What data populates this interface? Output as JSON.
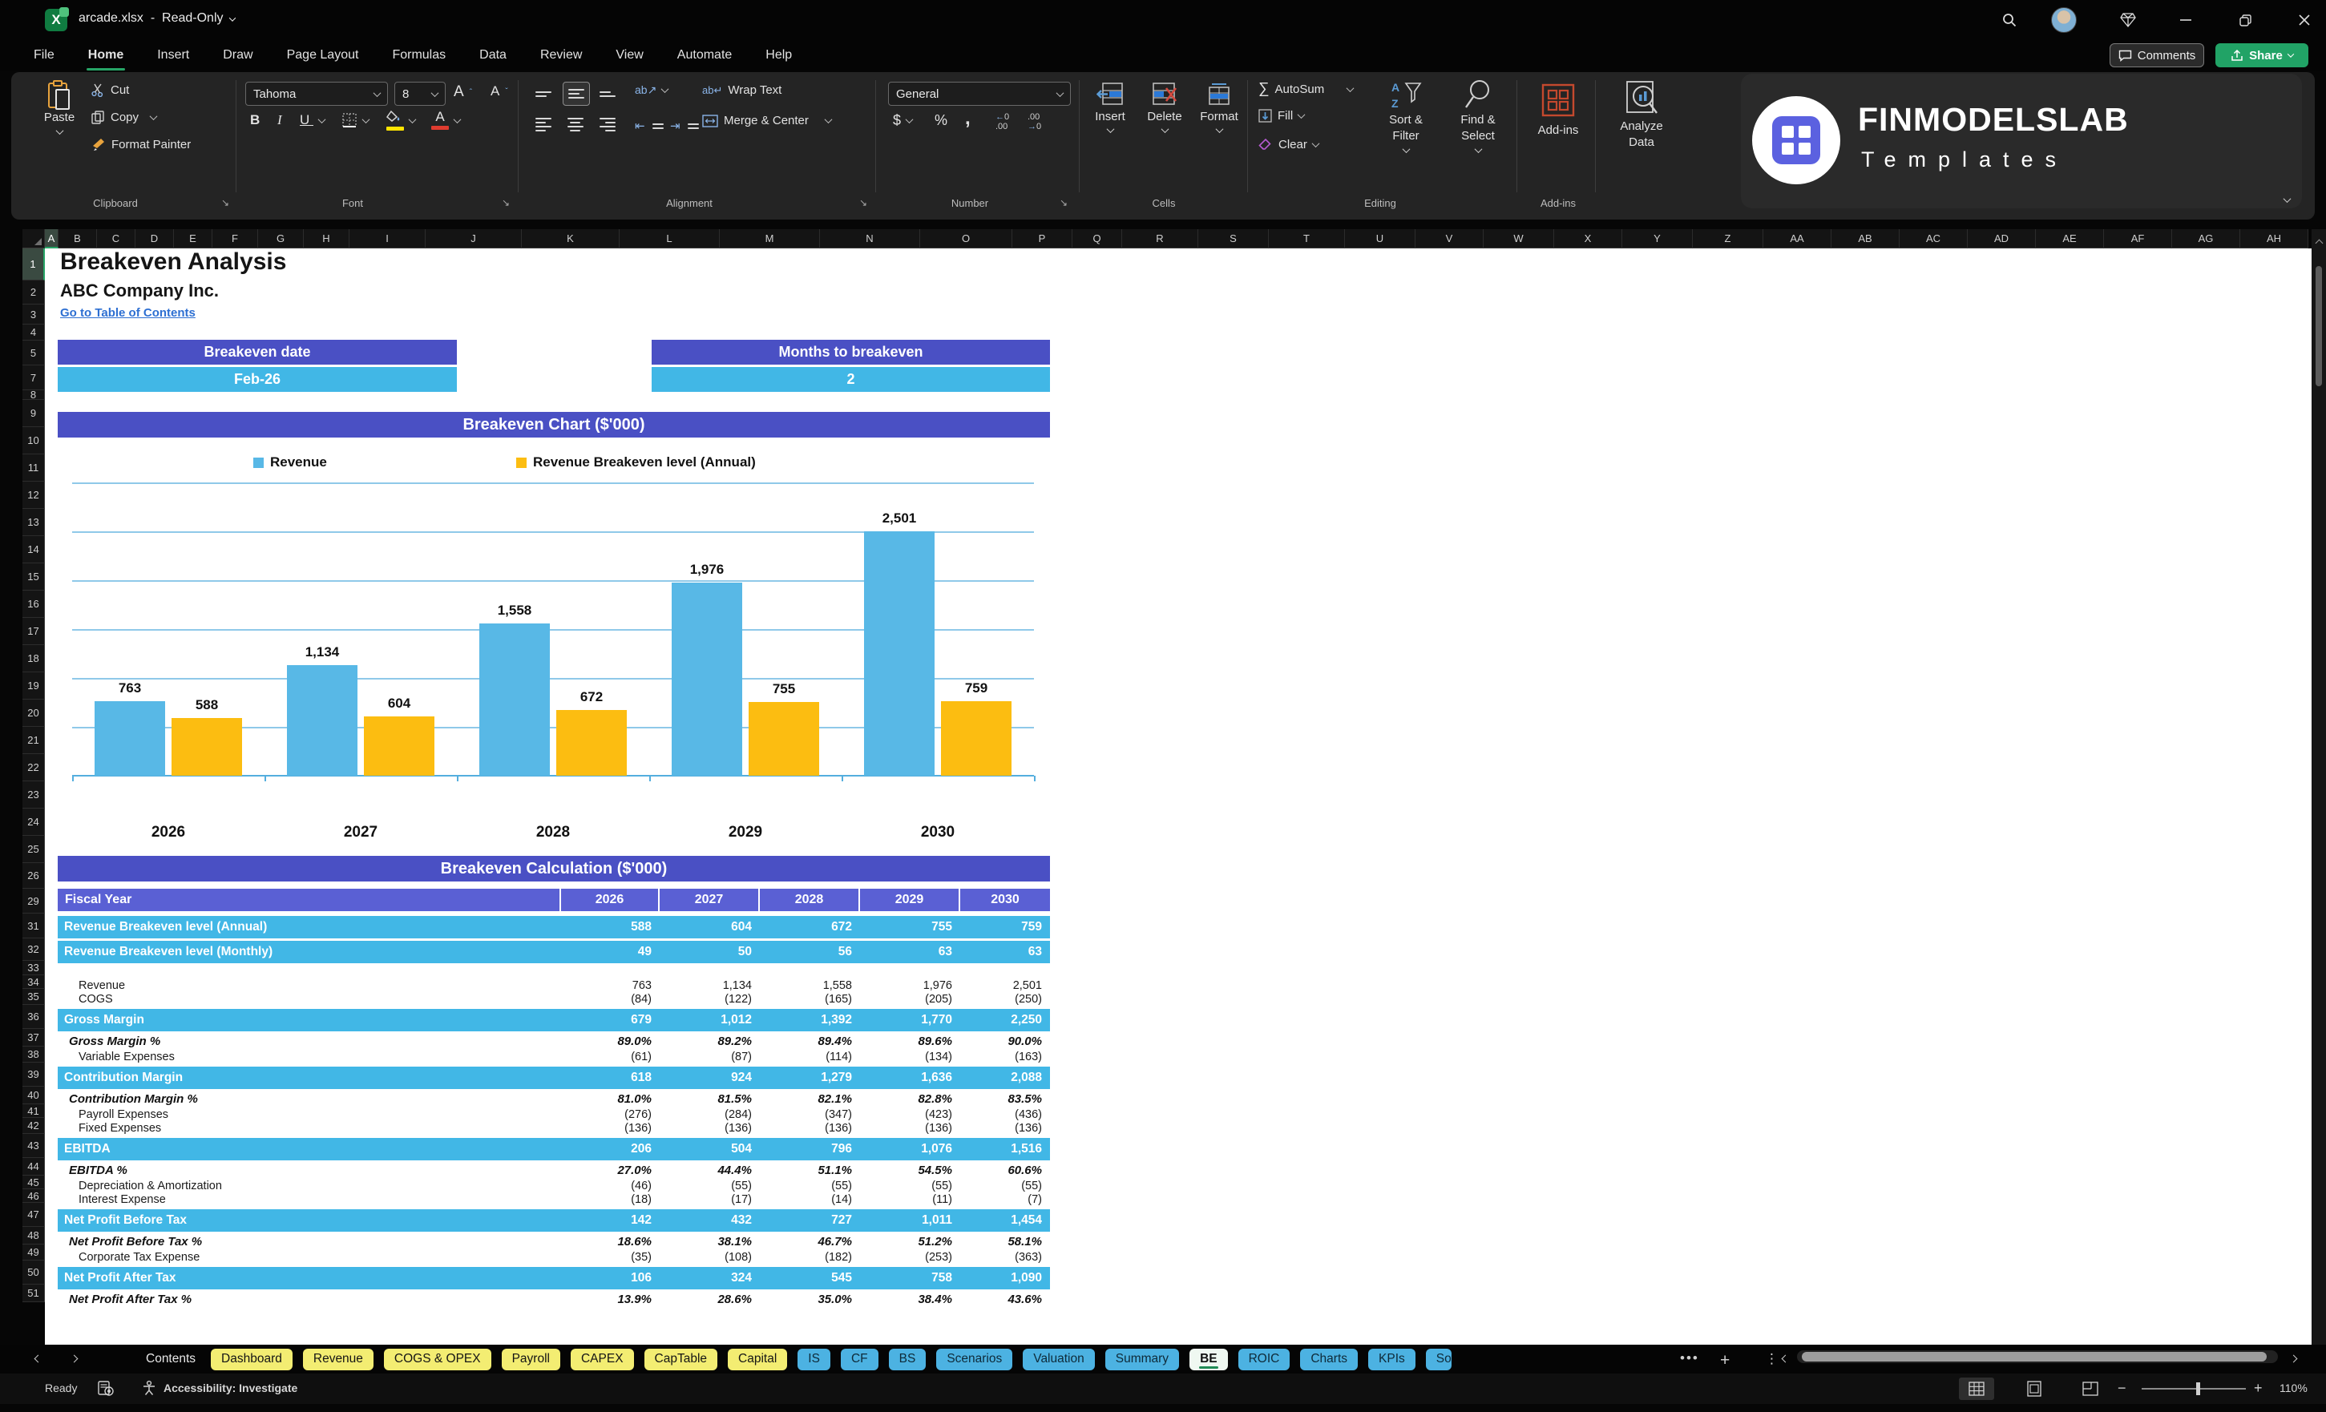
{
  "title_bar": {
    "file_name": "arcade.xlsx",
    "dash": "-",
    "mode": "Read-Only"
  },
  "menu": {
    "items": [
      "File",
      "Home",
      "Insert",
      "Draw",
      "Page Layout",
      "Formulas",
      "Data",
      "Review",
      "View",
      "Automate",
      "Help"
    ],
    "active": "Home",
    "comments_label": "Comments",
    "share_label": "Share"
  },
  "ribbon": {
    "clipboard": {
      "label": "Clipboard",
      "paste": "Paste",
      "cut": "Cut",
      "copy": "Copy",
      "format_painter": "Format Painter"
    },
    "font": {
      "label": "Font",
      "family": "Tahoma",
      "size": "8"
    },
    "alignment": {
      "label": "Alignment",
      "wrap_text": "Wrap Text",
      "merge_center": "Merge & Center"
    },
    "number": {
      "label": "Number",
      "format": "General"
    },
    "cells": {
      "label": "Cells",
      "insert": "Insert",
      "delete": "Delete",
      "format": "Format"
    },
    "editing": {
      "label": "Editing",
      "autosum": "AutoSum",
      "fill": "Fill",
      "clear": "Clear",
      "sort_filter": "Sort & Filter",
      "find_select": "Find & Select"
    },
    "addins": {
      "label": "Add-ins",
      "addins_btn": "Add-ins",
      "analyze": "Analyze Data"
    },
    "logo": {
      "brand": "FINMODELSLAB",
      "sub": "Templates"
    }
  },
  "grid": {
    "columns": [
      "A",
      "B",
      "C",
      "D",
      "E",
      "F",
      "G",
      "H",
      "I",
      "J",
      "K",
      "L",
      "M",
      "N",
      "O",
      "P",
      "Q",
      "R",
      "S",
      "T",
      "U",
      "V",
      "W",
      "X",
      "Y",
      "Z",
      "AA",
      "AB",
      "AC",
      "AD",
      "AE",
      "AF",
      "AG",
      "AH"
    ],
    "rows": [
      "1",
      "2",
      "3",
      "4",
      "5",
      "7",
      "8",
      "9",
      "10",
      "11",
      "12",
      "13",
      "14",
      "15",
      "16",
      "17",
      "18",
      "19",
      "20",
      "21",
      "22",
      "23",
      "24",
      "25",
      "26",
      "29",
      "31",
      "32",
      "33",
      "34",
      "35",
      "36",
      "37",
      "38",
      "39",
      "40",
      "41",
      "42",
      "43",
      "44",
      "45",
      "46",
      "47",
      "48",
      "49",
      "50",
      "51"
    ]
  },
  "sheet": {
    "title": "Breakeven Analysis",
    "company": "ABC Company Inc.",
    "link": "Go to Table of Contents",
    "breakeven_date_label": "Breakeven date",
    "breakeven_date_value": "Feb-26",
    "months_label": "Months to breakeven",
    "months_value": "2",
    "chart_title": "Breakeven Chart ($'000)",
    "calc_title": "Breakeven Calculation ($'000)"
  },
  "chart_data": {
    "type": "bar",
    "title": "Breakeven Chart ($'000)",
    "categories": [
      "2026",
      "2027",
      "2028",
      "2029",
      "2030"
    ],
    "series": [
      {
        "name": "Revenue",
        "color": "#58b8e6",
        "values": [
          763,
          1134,
          1558,
          1976,
          2501
        ],
        "labels": [
          "763",
          "1,134",
          "1,558",
          "1,976",
          "2,501"
        ]
      },
      {
        "name": "Revenue Breakeven level (Annual)",
        "color": "#fcbd11",
        "values": [
          588,
          604,
          672,
          755,
          759
        ],
        "labels": [
          "588",
          "604",
          "672",
          "755",
          "759"
        ]
      }
    ],
    "xlabel": "",
    "ylabel": "",
    "ylim": [
      0,
      3000
    ],
    "gridline_step": 500,
    "grid": true,
    "legend_position": "top"
  },
  "table": {
    "header": {
      "label": "Fiscal Year",
      "years": [
        "2026",
        "2027",
        "2028",
        "2029",
        "2030"
      ]
    },
    "rows": [
      {
        "label": "Revenue Breakeven level (Annual)",
        "values": [
          "588",
          "604",
          "672",
          "755",
          "759"
        ],
        "style": "highlight"
      },
      {
        "label": "Revenue Breakeven level (Monthly)",
        "values": [
          "49",
          "50",
          "56",
          "63",
          "63"
        ],
        "style": "highlight"
      },
      {
        "label": "",
        "values": [
          "",
          "",
          "",
          "",
          ""
        ],
        "style": "spacer"
      },
      {
        "label": "Revenue",
        "values": [
          "763",
          "1,134",
          "1,558",
          "1,976",
          "2,501"
        ],
        "style": "plain"
      },
      {
        "label": "COGS",
        "values": [
          "(84)",
          "(122)",
          "(165)",
          "(205)",
          "(250)"
        ],
        "style": "plain"
      },
      {
        "label": "Gross Margin",
        "values": [
          "679",
          "1,012",
          "1,392",
          "1,770",
          "2,250"
        ],
        "style": "highlight"
      },
      {
        "label": "Gross Margin %",
        "values": [
          "89.0%",
          "89.2%",
          "89.4%",
          "89.6%",
          "90.0%"
        ],
        "style": "pct"
      },
      {
        "label": "Variable Expenses",
        "values": [
          "(61)",
          "(87)",
          "(114)",
          "(134)",
          "(163)"
        ],
        "style": "plain"
      },
      {
        "label": "Contribution Margin",
        "values": [
          "618",
          "924",
          "1,279",
          "1,636",
          "2,088"
        ],
        "style": "highlight"
      },
      {
        "label": "Contribution Margin %",
        "values": [
          "81.0%",
          "81.5%",
          "82.1%",
          "82.8%",
          "83.5%"
        ],
        "style": "pct"
      },
      {
        "label": "Payroll Expenses",
        "values": [
          "(276)",
          "(284)",
          "(347)",
          "(423)",
          "(436)"
        ],
        "style": "plain"
      },
      {
        "label": "Fixed Expenses",
        "values": [
          "(136)",
          "(136)",
          "(136)",
          "(136)",
          "(136)"
        ],
        "style": "plain"
      },
      {
        "label": "EBITDA",
        "values": [
          "206",
          "504",
          "796",
          "1,076",
          "1,516"
        ],
        "style": "highlight"
      },
      {
        "label": "EBITDA %",
        "values": [
          "27.0%",
          "44.4%",
          "51.1%",
          "54.5%",
          "60.6%"
        ],
        "style": "pct"
      },
      {
        "label": "Depreciation & Amortization",
        "values": [
          "(46)",
          "(55)",
          "(55)",
          "(55)",
          "(55)"
        ],
        "style": "plain"
      },
      {
        "label": "Interest Expense",
        "values": [
          "(18)",
          "(17)",
          "(14)",
          "(11)",
          "(7)"
        ],
        "style": "plain"
      },
      {
        "label": "Net Profit Before Tax",
        "values": [
          "142",
          "432",
          "727",
          "1,011",
          "1,454"
        ],
        "style": "highlight"
      },
      {
        "label": "Net Profit Before Tax %",
        "values": [
          "18.6%",
          "38.1%",
          "46.7%",
          "51.2%",
          "58.1%"
        ],
        "style": "pct"
      },
      {
        "label": "Corporate Tax Expense",
        "values": [
          "(35)",
          "(108)",
          "(182)",
          "(253)",
          "(363)"
        ],
        "style": "plain"
      },
      {
        "label": "Net Profit After Tax",
        "values": [
          "106",
          "324",
          "545",
          "758",
          "1,090"
        ],
        "style": "highlight"
      },
      {
        "label": "Net Profit After Tax %",
        "values": [
          "13.9%",
          "28.6%",
          "35.0%",
          "38.4%",
          "43.6%"
        ],
        "style": "pct"
      }
    ]
  },
  "sheet_tabs": {
    "tabs": [
      {
        "label": "Contents",
        "type": "plain"
      },
      {
        "label": "Dashboard",
        "type": "yellow"
      },
      {
        "label": "Revenue",
        "type": "yellow"
      },
      {
        "label": "COGS & OPEX",
        "type": "yellow"
      },
      {
        "label": "Payroll",
        "type": "yellow"
      },
      {
        "label": "CAPEX",
        "type": "yellow"
      },
      {
        "label": "CapTable",
        "type": "yellow"
      },
      {
        "label": "Capital",
        "type": "yellow"
      },
      {
        "label": "IS",
        "type": "blue"
      },
      {
        "label": "CF",
        "type": "blue"
      },
      {
        "label": "BS",
        "type": "blue"
      },
      {
        "label": "Scenarios",
        "type": "blue"
      },
      {
        "label": "Valuation",
        "type": "blue"
      },
      {
        "label": "Summary",
        "type": "blue"
      },
      {
        "label": "BE",
        "type": "active"
      },
      {
        "label": "ROIC",
        "type": "blue"
      },
      {
        "label": "Charts",
        "type": "blue"
      },
      {
        "label": "KPIs",
        "type": "blue"
      },
      {
        "label": "So",
        "type": "blue-clipped"
      }
    ],
    "active": "BE"
  },
  "status_bar": {
    "ready": "Ready",
    "accessibility": "Accessibility: Investigate",
    "zoom_level": "110%"
  },
  "colors": {
    "accent_purple": "#4a50c4",
    "accent_purple_light": "#5a60d4",
    "accent_blue": "#41b7e6",
    "chart_blue": "#58b8e6",
    "chart_yellow": "#fcbd11",
    "excel_green": "#21a366",
    "link_blue": "#2d6fd2"
  }
}
